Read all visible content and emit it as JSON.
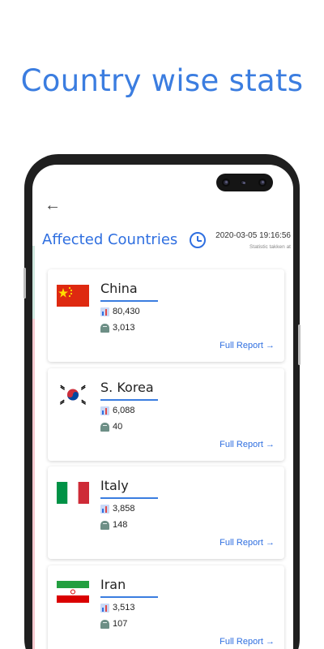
{
  "headline": "Country wise stats",
  "screen": {
    "title": "Affected Countries",
    "timestamp": "2020-03-05 19:16:56",
    "timestamp_caption": "Statistic takken at"
  },
  "countries": [
    {
      "name": "China",
      "cases": "80,430",
      "deaths": "3,013",
      "report_label": "Full Report →"
    },
    {
      "name": "S. Korea",
      "cases": "6,088",
      "deaths": "40",
      "report_label": "Full Report →"
    },
    {
      "name": "Italy",
      "cases": "3,858",
      "deaths": "148",
      "report_label": "Full Report →"
    },
    {
      "name": "Iran",
      "cases": "3,513",
      "deaths": "107",
      "report_label": "Full Report →"
    }
  ],
  "icons": {
    "back": "back-arrow-icon",
    "clock": "clock-icon",
    "cases": "chart-icon",
    "deaths": "tombstone-icon"
  },
  "colors": {
    "accent": "#3b7de0",
    "text": "#222222"
  }
}
